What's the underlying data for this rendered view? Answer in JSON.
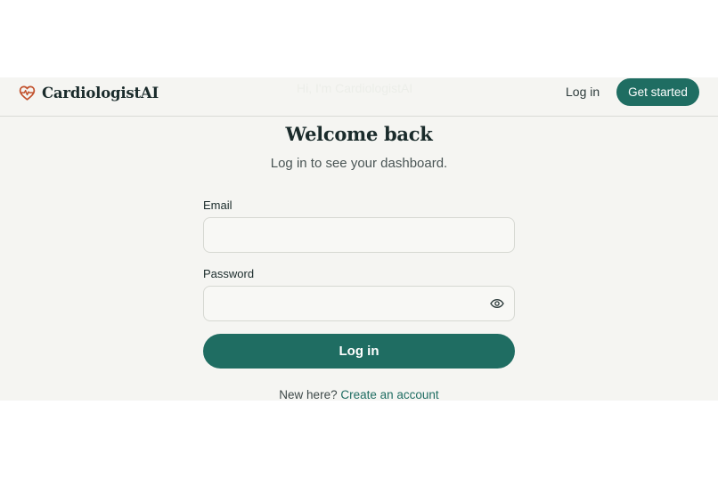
{
  "header": {
    "brand_name": "CardiologistAI",
    "faded_text": "Hi, I'm CardiologistAI",
    "login_label": "Log in",
    "cta_label": "Get started"
  },
  "main": {
    "title": "Welcome back",
    "subtitle": "Log in to see your dashboard.",
    "email_label": "Email",
    "email_value": "",
    "password_label": "Password",
    "password_value": "",
    "submit_label": "Log in",
    "signup_prompt": "New here?",
    "signup_link": "Create an account"
  },
  "icons": {
    "logo": "heart-pulse-icon",
    "password_toggle": "eye-icon"
  },
  "colors": {
    "accent": "#1f6d62",
    "logo": "#c2512c",
    "background": "#f5f5f2",
    "text": "#1a2b2b"
  }
}
